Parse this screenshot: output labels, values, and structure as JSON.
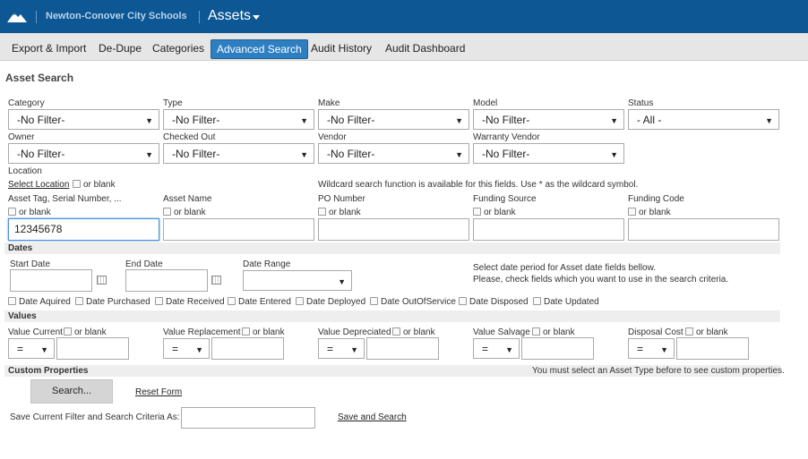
{
  "header": {
    "org_name": "Newton-Conover City Schools",
    "app_name": "Assets"
  },
  "nav": [
    "Export & Import",
    "De-Dupe",
    "Categories",
    "Advanced Search",
    "Audit History",
    "Audit Dashboard"
  ],
  "page_title": "Asset Search",
  "filters": {
    "category": {
      "label": "Category",
      "value": "-No Filter-"
    },
    "type": {
      "label": "Type",
      "value": "-No Filter-"
    },
    "make": {
      "label": "Make",
      "value": "-No Filter-"
    },
    "model": {
      "label": "Model",
      "value": "-No Filter-"
    },
    "status": {
      "label": "Status",
      "value": "- All -"
    },
    "owner": {
      "label": "Owner",
      "value": "-No Filter-"
    },
    "checked_out": {
      "label": "Checked Out",
      "value": "-No Filter-"
    },
    "vendor": {
      "label": "Vendor",
      "value": "-No Filter-"
    },
    "warranty_vendor": {
      "label": "Warranty Vendor",
      "value": "-No Filter-"
    }
  },
  "location": {
    "label": "Location",
    "select_link": "Select Location",
    "or_blank": "or blank",
    "wildcard_note": "Wildcard search function is available for this fields. Use * as the wildcard symbol."
  },
  "text_fields": {
    "asset_tag": {
      "label": "Asset Tag, Serial Number, ...",
      "value": "12345678"
    },
    "asset_name": {
      "label": "Asset Name",
      "value": ""
    },
    "po_number": {
      "label": "PO Number",
      "value": ""
    },
    "funding_source": {
      "label": "Funding Source",
      "value": ""
    },
    "funding_code": {
      "label": "Funding Code",
      "value": ""
    }
  },
  "or_blank": "or blank",
  "dates": {
    "section": "Dates",
    "start_date": "Start Date",
    "end_date": "End Date",
    "date_range": "Date Range",
    "note_line1": "Select date period for Asset date fields bellow.",
    "note_line2": "Please, check fields which you want to use in the search criteria.",
    "fields": [
      "Date Aquired",
      "Date Purchased",
      "Date Received",
      "Date Entered",
      "Date Deployed",
      "Date OutOfService",
      "Date Disposed",
      "Date Updated"
    ]
  },
  "values": {
    "section": "Values",
    "operator": "=",
    "fields": [
      "Value Current",
      "Value Replacement",
      "Value Depreciated",
      "Value Salvage",
      "Disposal Cost"
    ]
  },
  "custom": {
    "section": "Custom Properties",
    "note": "You must select an Asset Type before to see custom properties."
  },
  "actions": {
    "search": "Search...",
    "reset": "Reset Form",
    "save_label": "Save Current Filter and Search Criteria As:",
    "save_link": "Save and Search"
  },
  "colors": {
    "header_bg": "#0c5794",
    "active_tab": "#2e7fc2"
  }
}
